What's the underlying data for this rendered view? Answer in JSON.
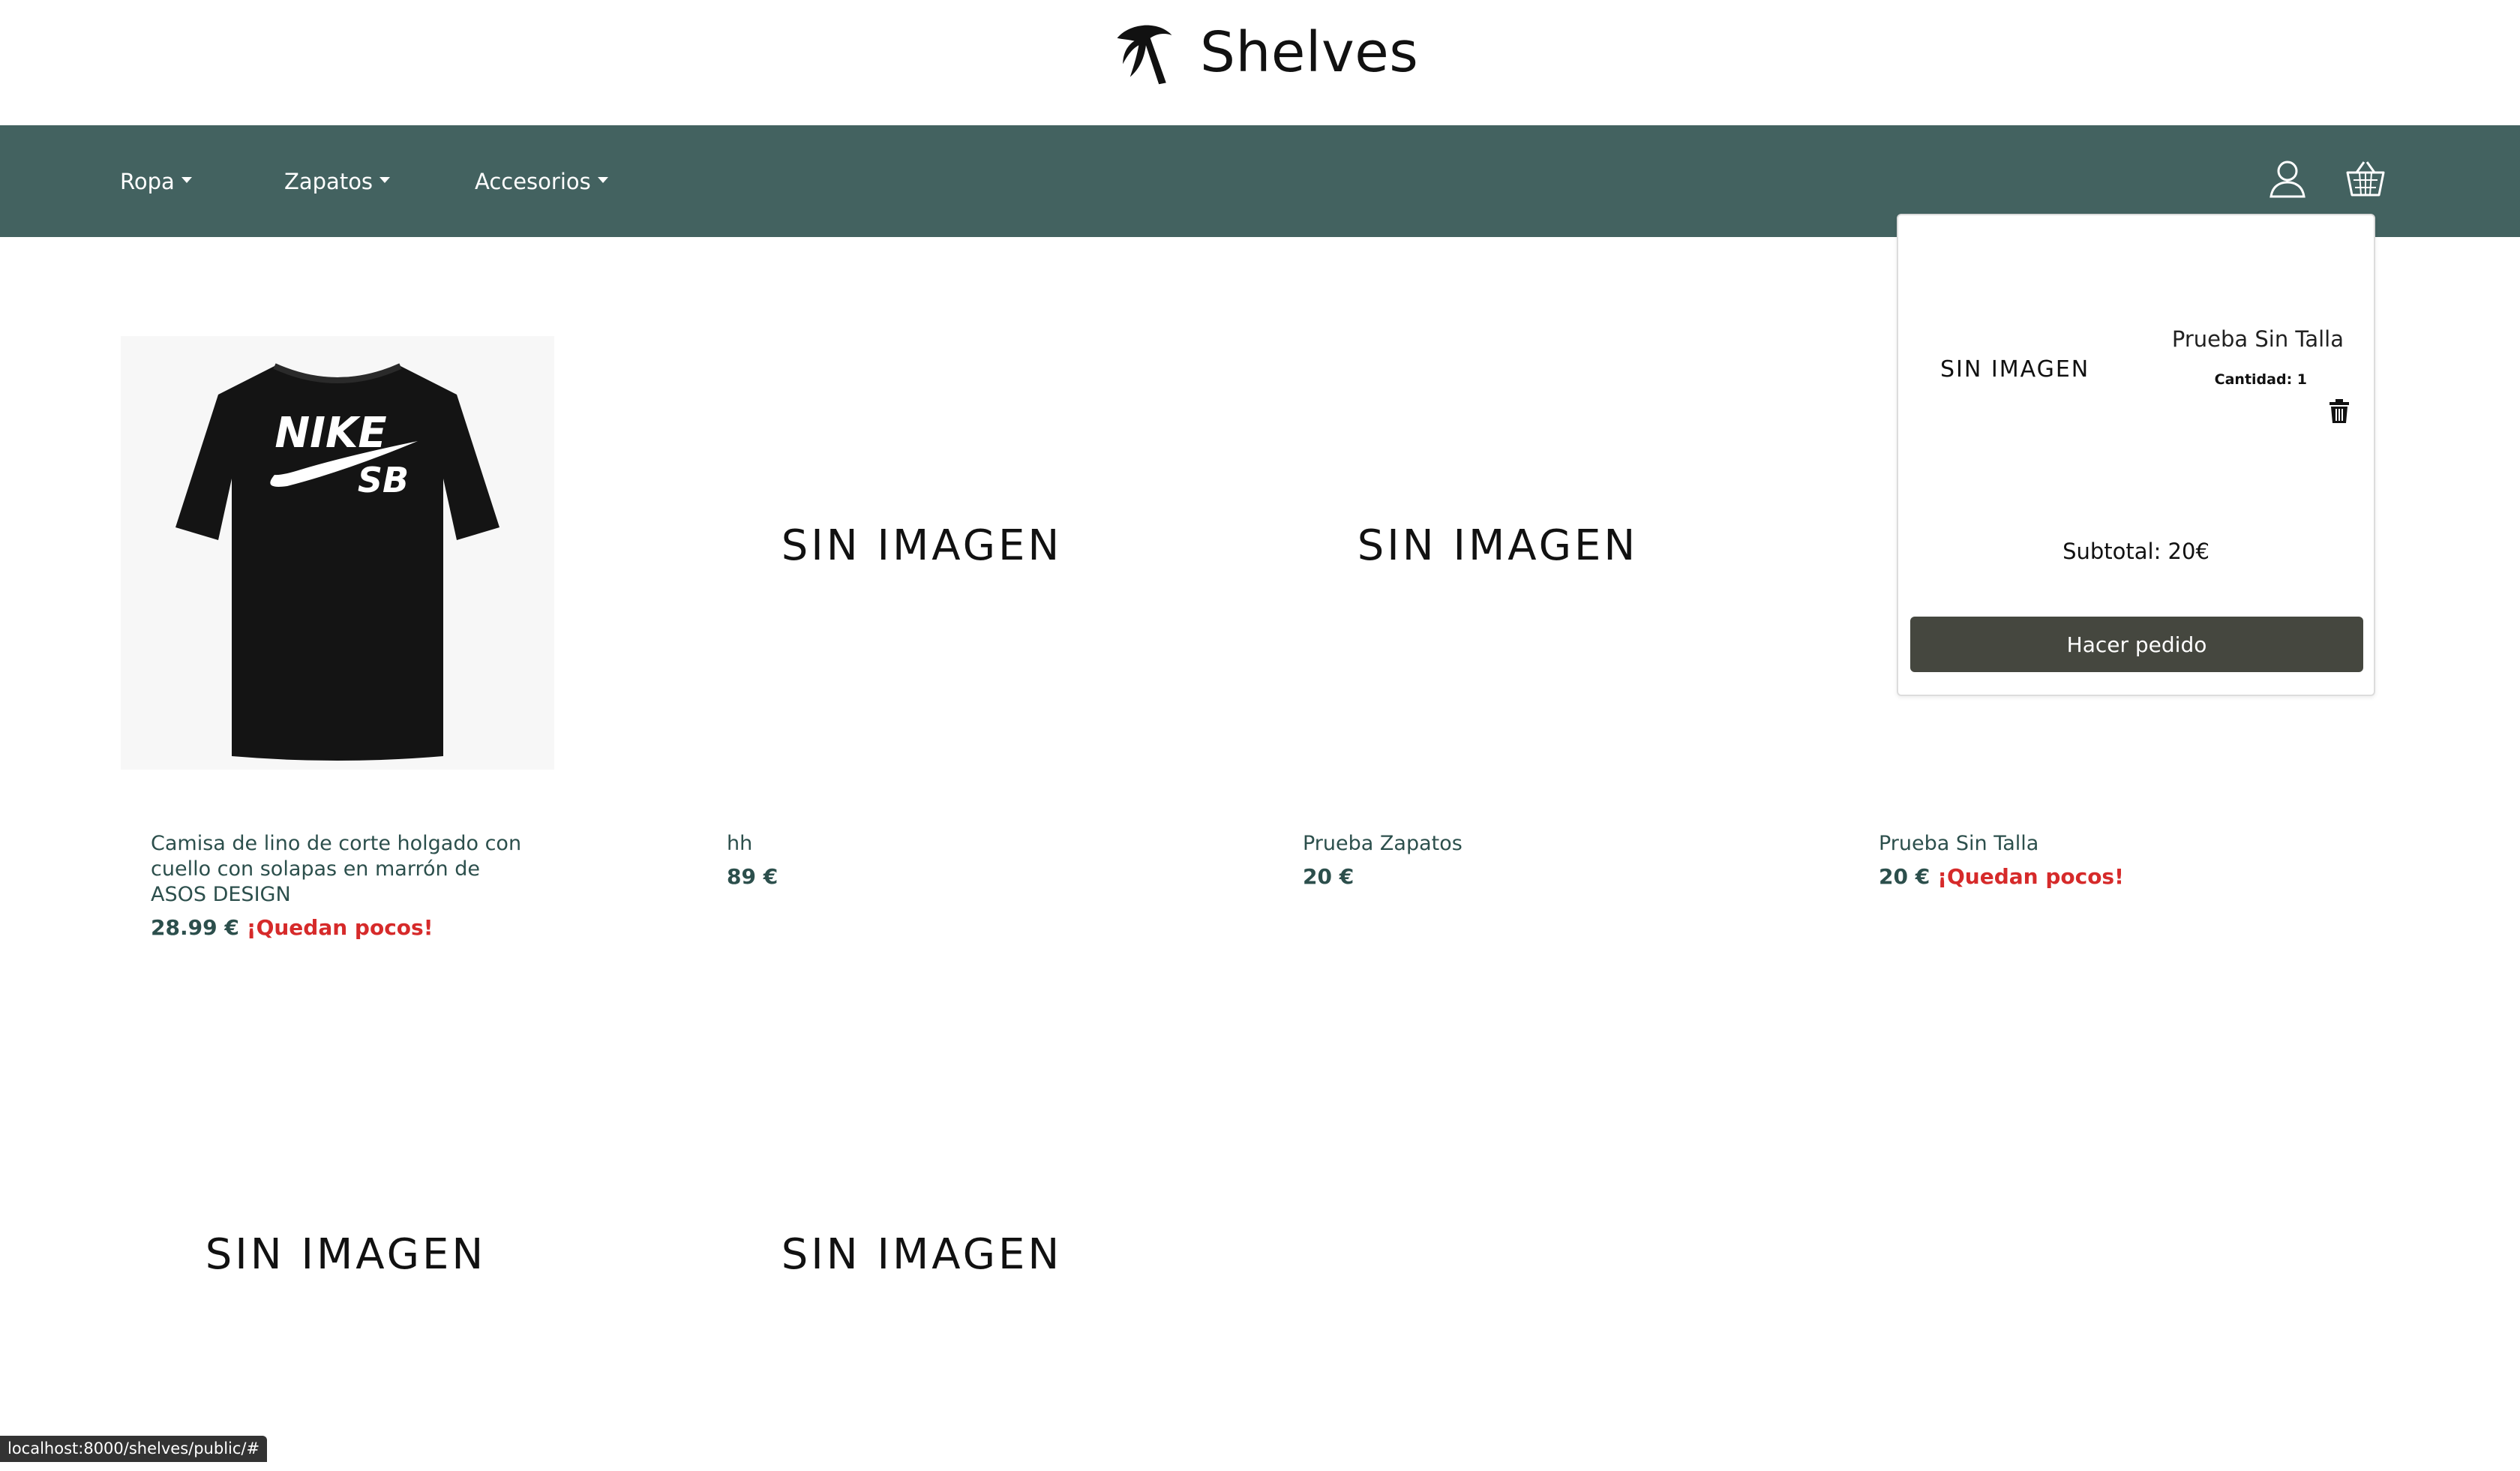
{
  "brand": {
    "name": "Shelves"
  },
  "nav": {
    "items": [
      {
        "label": "Ropa"
      },
      {
        "label": "Zapatos"
      },
      {
        "label": "Accesorios"
      }
    ],
    "icons": [
      "user-icon",
      "basket-icon"
    ]
  },
  "products": [
    {
      "name": "Camisa de lino de corte holgado con cuello con solapas en marrón de ASOS DESIGN",
      "price": "28.99 €",
      "stock_note": "¡Quedan pocos!",
      "image": "nike-sb-tshirt"
    },
    {
      "name": "hh",
      "price": "89 €",
      "image_text": "SIN IMAGEN"
    },
    {
      "name": "Prueba Zapatos",
      "price": "20 €",
      "image_text": "SIN IMAGEN"
    },
    {
      "name": "Prueba Sin Talla",
      "price": "20 €",
      "stock_note": "¡Quedan pocos!"
    },
    {
      "image_text": "SIN IMAGEN"
    },
    {
      "image_text": "SIN IMAGEN"
    }
  ],
  "cart": {
    "item": {
      "image_text": "SIN IMAGEN",
      "name": "Prueba Sin Talla",
      "quantity": "Cantidad: 1"
    },
    "subtotal": "Subtotal: 20€",
    "order_button": "Hacer pedido"
  },
  "status_bar": {
    "url": "localhost:8000/shelves/public/#"
  },
  "colors": {
    "nav_bg": "#436260",
    "product_text": "#2c4f4c",
    "low_stock": "#d62a2a",
    "order_button": "#45473f"
  }
}
